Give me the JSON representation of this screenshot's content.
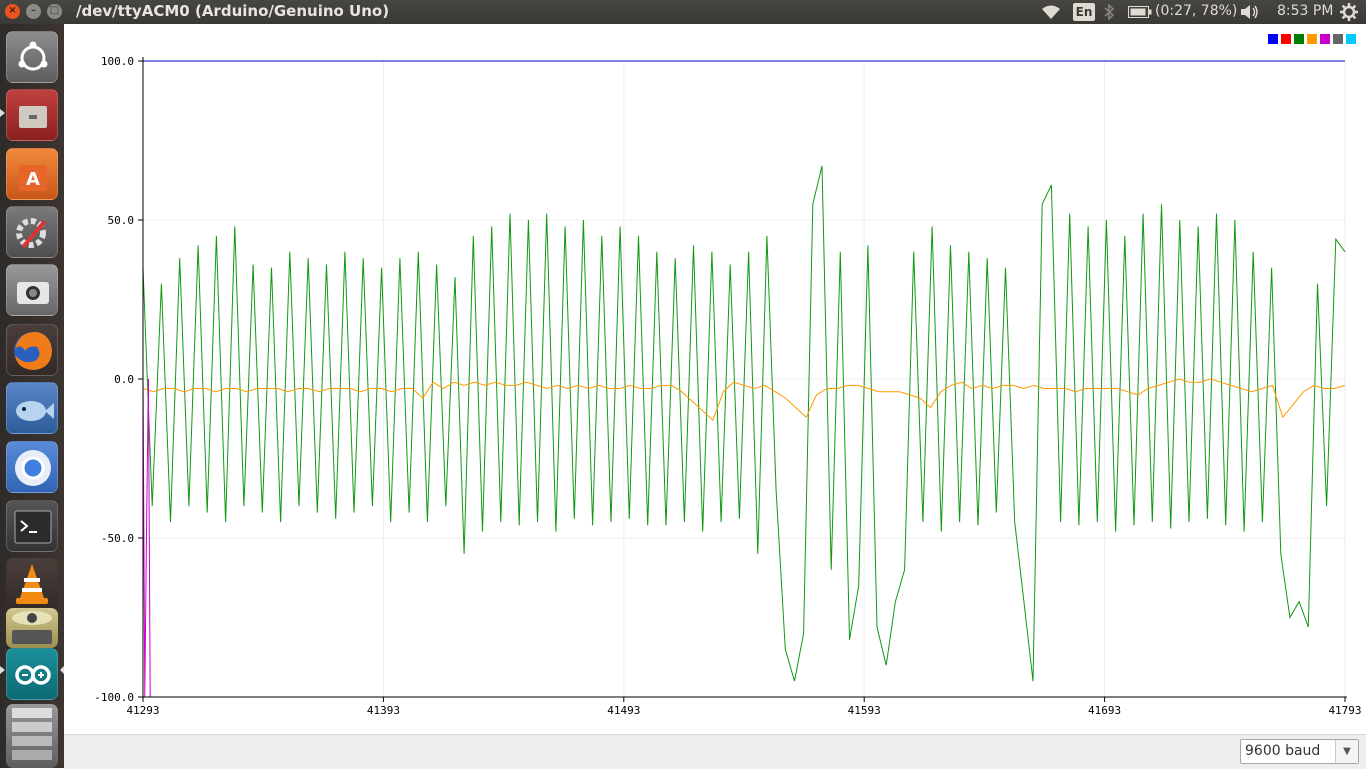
{
  "window": {
    "title": "/dev/ttyACM0 (Arduino/Genuino Uno)",
    "close_glyph": "×",
    "min_glyph": "–",
    "max_glyph": "□"
  },
  "tray": {
    "language": "En",
    "battery": "(0:27, 78%)",
    "clock": "8:53 PM",
    "icons": [
      "wifi-icon",
      "keyboard-language",
      "bluetooth-icon",
      "battery-icon",
      "volume-icon",
      "power-gear-icon"
    ]
  },
  "launcher": {
    "items": [
      "ubuntu-dash",
      "files",
      "software-center",
      "system-settings",
      "screenshot",
      "firefox",
      "shotwell",
      "chromium",
      "terminal",
      "vlc",
      "scanner",
      "arduino-ide",
      "workspace-switcher"
    ]
  },
  "plotter": {
    "series_colors": [
      "#0000ff",
      "#ff0000",
      "#008000",
      "#ff9900",
      "#cc00cc",
      "#666666",
      "#00ccff"
    ]
  },
  "chart_data": {
    "type": "line",
    "ylim": [
      -100,
      100
    ],
    "xlim": [
      41293,
      41793
    ],
    "y_ticks": [
      "100.0",
      "50.0",
      "0.0",
      "-50.0",
      "-100.0"
    ],
    "y_tick_values": [
      100,
      50,
      0,
      -50,
      -100
    ],
    "x_ticks": [
      "41293",
      "41393",
      "41493",
      "41593",
      "41693",
      "41793"
    ],
    "x_tick_values": [
      41293,
      41393,
      41493,
      41593,
      41693,
      41793
    ],
    "grid": true,
    "legend": "top-right",
    "series": [
      {
        "color": "#0000cc",
        "x_start": 41293,
        "x_end": 41793,
        "values": [
          100,
          100
        ]
      },
      {
        "color": "#dd0000",
        "x_start": 41293,
        "x_end": 41793,
        "values": [
          -100,
          -100
        ]
      },
      {
        "color": "#119911",
        "x_start": 41293,
        "x_end": 41793,
        "values": [
          35,
          -40,
          30,
          -45,
          38,
          -40,
          42,
          -42,
          45,
          -45,
          48,
          -40,
          36,
          -42,
          35,
          -45,
          40,
          -40,
          38,
          -42,
          36,
          -44,
          40,
          -42,
          38,
          -40,
          35,
          -45,
          38,
          -42,
          40,
          -45,
          36,
          -40,
          32,
          -55,
          45,
          -48,
          48,
          -45,
          52,
          -46,
          50,
          -45,
          52,
          -48,
          48,
          -44,
          50,
          -46,
          45,
          -45,
          48,
          -44,
          45,
          -46,
          40,
          -46,
          38,
          -45,
          42,
          -48,
          40,
          -45,
          36,
          -44,
          40,
          -55,
          45,
          -35,
          -85,
          -95,
          -80,
          55,
          67,
          -60,
          40,
          -82,
          -65,
          42,
          -78,
          -90,
          -70,
          -60,
          40,
          -45,
          48,
          -48,
          42,
          -45,
          40,
          -46,
          38,
          -42,
          35,
          -45,
          -70,
          -95,
          55,
          61,
          -45,
          52,
          -46,
          48,
          -45,
          50,
          -48,
          45,
          -46,
          52,
          -45,
          55,
          -47,
          50,
          -45,
          48,
          -44,
          52,
          -46,
          50,
          -48,
          40,
          -45,
          35,
          -55,
          -75,
          -70,
          -78,
          30,
          -40,
          44,
          40
        ]
      },
      {
        "color": "#ff9900",
        "x_start": 41293,
        "x_end": 41793,
        "values": [
          -3,
          -4,
          -3,
          -3,
          -4,
          -3,
          -3,
          -4,
          -3,
          -3,
          -4,
          -3,
          -3,
          -3,
          -4,
          -3,
          -3,
          -4,
          -3,
          -3,
          -3,
          -4,
          -3,
          -3,
          -4,
          -3,
          -3,
          -6,
          -1,
          -3,
          -1,
          -2,
          -1,
          -2,
          -1,
          -2,
          -2,
          -1,
          -2,
          -3,
          -2,
          -3,
          -2,
          -3,
          -2,
          -3,
          -3,
          -2,
          -3,
          -3,
          -2,
          -2,
          -4,
          -7,
          -10,
          -13,
          -4,
          -1,
          -2,
          -3,
          -2,
          -4,
          -6,
          -9,
          -12,
          -5,
          -3,
          -3,
          -2,
          -2,
          -3,
          -4,
          -4,
          -4,
          -5,
          -6,
          -9,
          -4,
          -2,
          -1,
          -3,
          -2,
          -3,
          -2,
          -2,
          -3,
          -2,
          -3,
          -3,
          -3,
          -4,
          -3,
          -3,
          -3,
          -3,
          -4,
          -5,
          -3,
          -2,
          -1,
          0,
          -1,
          -1,
          0,
          -1,
          -2,
          -3,
          -4,
          -3,
          -2,
          -12,
          -8,
          -4,
          -2,
          -3,
          -3,
          -2
        ]
      },
      {
        "color": "#cc00cc",
        "x_start": 41293,
        "x_end": 41296,
        "values": [
          0,
          -100,
          -45,
          0,
          -100
        ]
      }
    ]
  },
  "baud": {
    "selected": "9600 baud"
  }
}
